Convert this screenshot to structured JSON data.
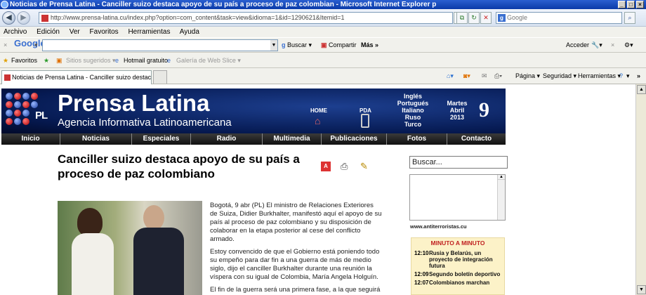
{
  "window": {
    "title": "Noticias de Prensa Latina - Canciller suizo destaca apoyo de su país a proceso de paz colombian - Microsoft Internet Explorer p",
    "buttons": [
      "_",
      "□",
      "×"
    ]
  },
  "navigation": {
    "url": "http://www.prensa-latina.cu/index.php?option=com_content&task=view&idioma=1&id=1290621&Itemid=1",
    "search_placeholder": "Google"
  },
  "menu": [
    "Archivo",
    "Edición",
    "Ver",
    "Favoritos",
    "Herramientas",
    "Ayuda"
  ],
  "google_toolbar": {
    "brand": "Google",
    "search_label": "Buscar",
    "share_label": "Compartir",
    "more_label": "Más »",
    "signin_label": "Acceder"
  },
  "favorites_bar": {
    "favorites_label": "Favoritos",
    "items": [
      "Sitios sugeridos ▾",
      "Hotmail gratuito",
      "Galería de Web Slice ▾"
    ]
  },
  "tab": {
    "label": "Noticias de Prensa Latina - Canciller suizo destaca apoyo..."
  },
  "command_bar": {
    "page_label": "Página ▾",
    "security_label": "Seguridad ▾",
    "tools_label": "Herramientas ▾",
    "help_label": "▾"
  },
  "site": {
    "logo_abbr": "PL",
    "name": "Prensa Latina",
    "subtitle": "Agencia Informativa Latinoamericana",
    "home_label": "HOME",
    "pda_label": "PDA",
    "languages": [
      "Inglés",
      "Portugués",
      "Italiano",
      "Ruso",
      "Turco"
    ],
    "date_weekday": "Martes",
    "date_month": "Abril",
    "date_year": "2013",
    "date_day": "9",
    "nav": [
      "Inicio",
      "Noticias",
      "Especiales",
      "Radio",
      "Multimedia",
      "Publicaciones",
      "Fotos",
      "Contacto"
    ]
  },
  "article": {
    "title": "Canciller suizo destaca apoyo de su país a proceso de paz colombiano",
    "paragraphs": [
      "Bogotá, 9 abr (PL) El ministro de Relaciones Exteriores de Suiza, Didier Burkhalter, manifestó aquí el apoyo de su país al proceso de paz colombiano y su disposición de colaborar en la etapa posterior al cese del conflicto armado.",
      "Estoy convencido de que el Gobierno está poniendo todo su empeño para dar fin a una guerra de más de medio siglo, dijo el canciller Burkhalter durante una reunión la víspera con su igual de Colombia, María Angela Holguín.",
      "El fin de la guerra será una primera fase, a la que seguirá"
    ]
  },
  "sidebar": {
    "search_value": "Buscar...",
    "antiterror_link": "www.antiterroristas.cu",
    "minuto_title": "MINUTO A MINUTO",
    "minuto_items": [
      {
        "time": "12:10",
        "headline": "Rusia y Belarús, un proyecto de integración futura"
      },
      {
        "time": "12:09",
        "headline": "Segundo boletín deportivo"
      },
      {
        "time": "12:07",
        "headline": "Colombianos marchan"
      }
    ]
  }
}
